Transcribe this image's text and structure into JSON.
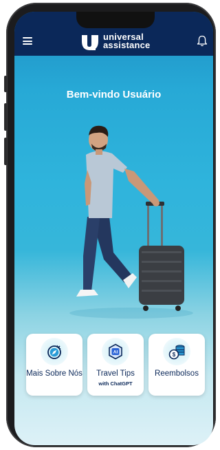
{
  "header": {
    "brand_line1": "universal",
    "brand_line2": "assistance"
  },
  "welcome": "Bem-vindo Usuário",
  "cards": [
    {
      "label": "Mais Sobre Nós",
      "subtitle": "",
      "icon": "compass-icon"
    },
    {
      "label": "Travel Tips",
      "subtitle": "with ChatGPT",
      "icon": "ai-chip-icon"
    },
    {
      "label": "Reembolsos",
      "subtitle": "",
      "icon": "coins-icon"
    }
  ],
  "colors": {
    "header_bg": "#0b2859",
    "accent": "#2fb4dc",
    "card_text": "#0b2859"
  }
}
